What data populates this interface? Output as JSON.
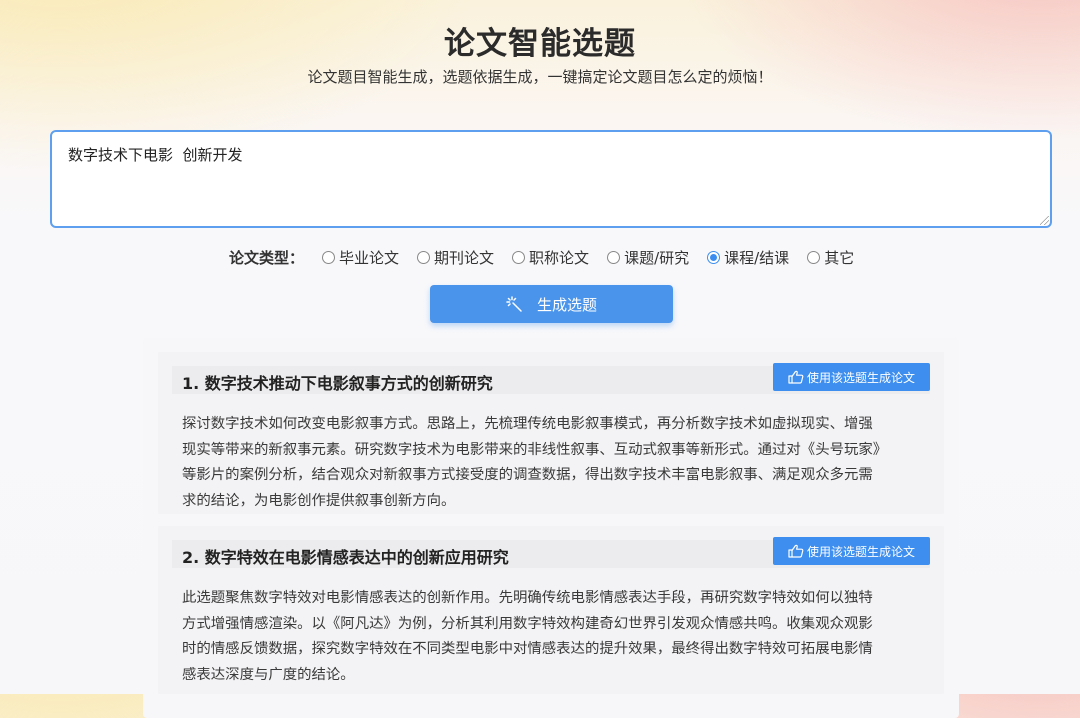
{
  "header": {
    "title": "论文智能选题",
    "subtitle": "论文题目智能生成，选题依据生成，一键搞定论文题目怎么定的烦恼！"
  },
  "input": {
    "value": "数字技术下电影  创新开发"
  },
  "paper_type": {
    "label": "论文类型：",
    "selected": "课程/结课",
    "options": [
      "毕业论文",
      "期刊论文",
      "职称论文",
      "课题/研究",
      "课程/结课",
      "其它"
    ]
  },
  "generate_button": {
    "label": "生成选题",
    "icon": "magic-wand-icon"
  },
  "results": [
    {
      "title": "1. 数字技术推动下电影叙事方式的创新研究",
      "button_label": "使用该选题生成论文",
      "button_icon": "thumbs-up-icon",
      "description_lines": [
        "探讨数字技术如何改变电影叙事方式。思路上，先梳理传统电影叙事模式，再分析数字技术如虚拟现实、增强",
        "现实等带来的新叙事元素。研究数字技术为电影带来的非线性叙事、互动式叙事等新形式。通过对《头号玩家》",
        "等影片的案例分析，结合观众对新叙事方式接受度的调查数据，得出数字技术丰富电影叙事、满足观众多元需",
        "求的结论，为电影创作提供叙事创新方向。"
      ]
    },
    {
      "title": "2. 数字特效在电影情感表达中的创新应用研究",
      "button_label": "使用该选题生成论文",
      "button_icon": "thumbs-up-icon",
      "description_lines": [
        "此选题聚焦数字特效对电影情感表达的创新作用。先明确传统电影情感表达手段，再研究数字特效如何以独特",
        "方式增强情感渲染。以《阿凡达》为例，分析其利用数字特效构建奇幻世界引发观众情感共鸣。收集观众观影",
        "时的情感反馈数据，探究数字特效在不同类型电影中对情感表达的提升效果，最终得出数字特效可拓展电影情",
        "感表达深度与广度的结论。"
      ]
    }
  ],
  "colors": {
    "primary": "#4a94ec",
    "button": "#3d8eee",
    "input_border": "#5ea0ef"
  }
}
